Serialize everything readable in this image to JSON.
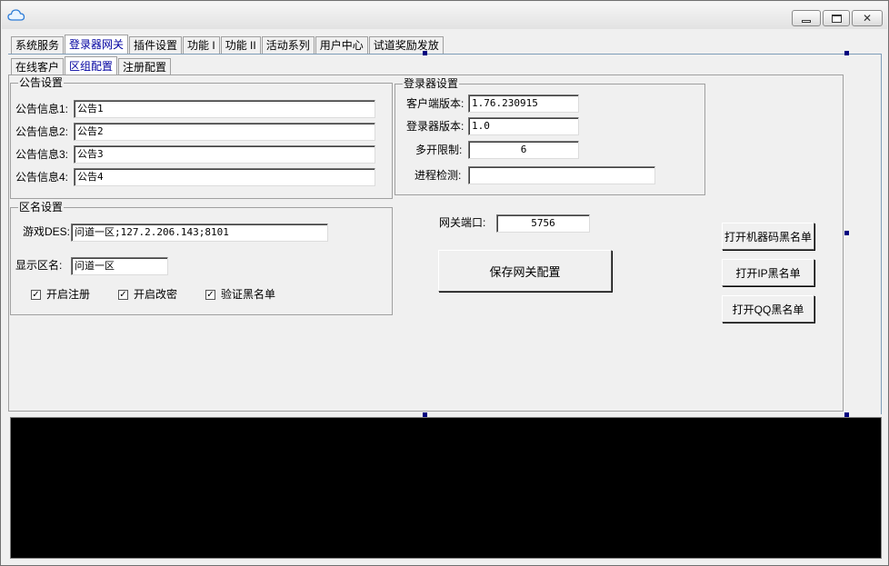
{
  "window": {
    "title": ""
  },
  "main_tabs": [
    {
      "label": "系统服务",
      "active": false
    },
    {
      "label": "登录器网关",
      "active": true
    },
    {
      "label": "插件设置",
      "active": false
    },
    {
      "label": "功能 I",
      "active": false
    },
    {
      "label": "功能 II",
      "active": false
    },
    {
      "label": "活动系列",
      "active": false
    },
    {
      "label": "用户中心",
      "active": false
    },
    {
      "label": "试道奖励发放",
      "active": false
    }
  ],
  "sub_tabs": [
    {
      "label": "在线客户",
      "active": false
    },
    {
      "label": "区组配置",
      "active": true
    },
    {
      "label": "注册配置",
      "active": false
    }
  ],
  "notice": {
    "title": "公告设置",
    "rows": [
      {
        "label": "公告信息1:",
        "value": "公告1"
      },
      {
        "label": "公告信息2:",
        "value": "公告2"
      },
      {
        "label": "公告信息3:",
        "value": "公告3"
      },
      {
        "label": "公告信息4:",
        "value": "公告4"
      }
    ]
  },
  "login": {
    "title": "登录器设置",
    "client_version_label": "客户端版本:",
    "client_version": "1.76.230915",
    "launcher_version_label": "登录器版本:",
    "launcher_version": "1.0",
    "multi_label": "多开限制:",
    "multi_value": "6",
    "process_label": "进程检测:",
    "process_value": ""
  },
  "zone": {
    "title": "区名设置",
    "des_label": "游戏DES:",
    "des_value": "问道一区;127.2.206.143;8101",
    "name_label": "显示区名:",
    "name_value": "问道一区",
    "checks": [
      {
        "label": "开启注册",
        "checked": true
      },
      {
        "label": "开启改密",
        "checked": true
      },
      {
        "label": "验证黑名单",
        "checked": true
      }
    ]
  },
  "gateway": {
    "port_label": "网关端口:",
    "port_value": "5756",
    "save_label": "保存网关配置"
  },
  "blacklist_buttons": {
    "machine": "打开机器码黑名单",
    "ip": "打开IP黑名单",
    "qq": "打开QQ黑名单"
  },
  "colors": {
    "active_tab_text": "#0000a0",
    "console_bg": "#000000",
    "handle": "#00007f"
  }
}
